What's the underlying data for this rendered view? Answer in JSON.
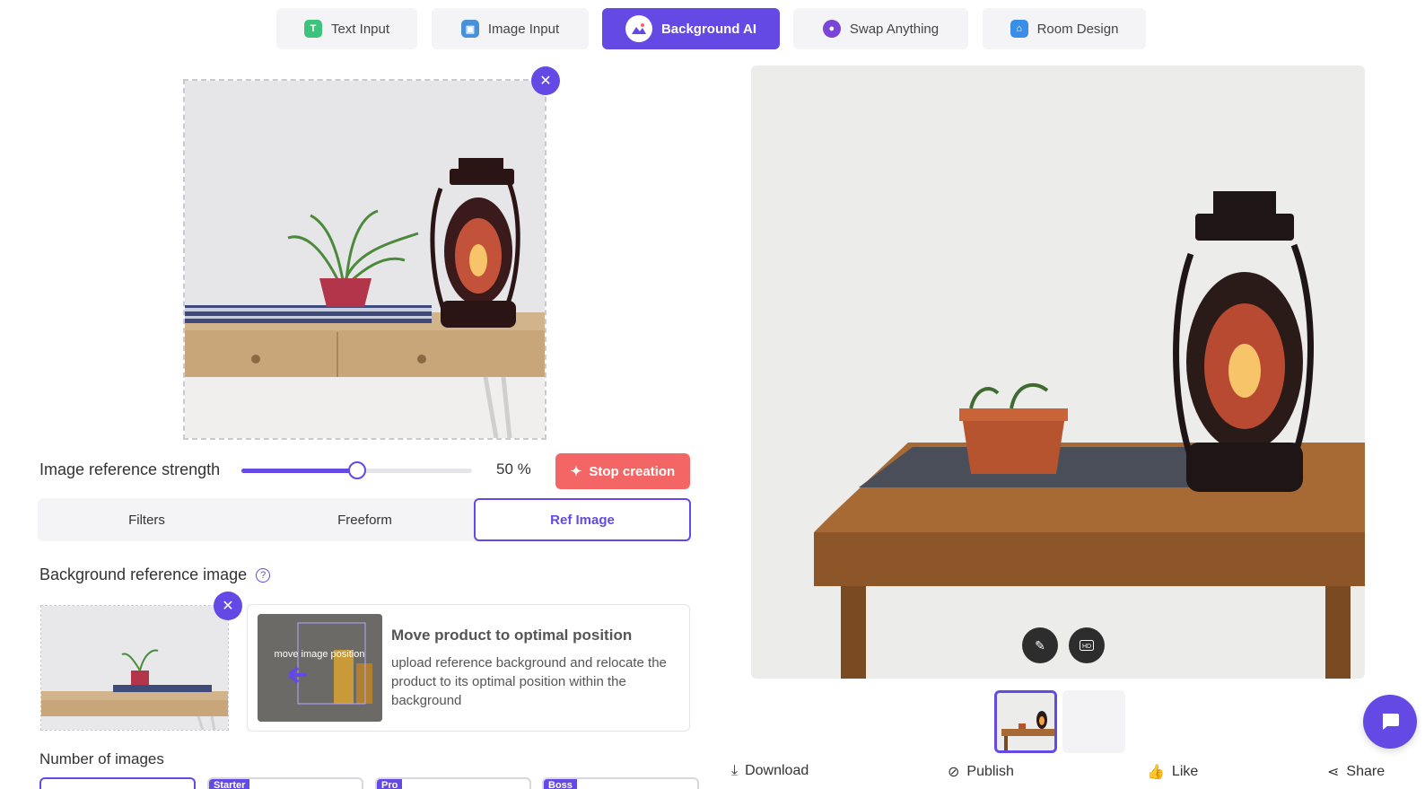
{
  "tabs": [
    {
      "label": "Text Input",
      "icon": "text-input-icon"
    },
    {
      "label": "Image Input",
      "icon": "image-input-icon"
    },
    {
      "label": "Background AI",
      "icon": "background-ai-icon",
      "active": true
    },
    {
      "label": "Swap Anything",
      "icon": "swap-anything-icon"
    },
    {
      "label": "Room Design",
      "icon": "room-design-icon"
    }
  ],
  "editor": {
    "slider_label": "Image reference strength",
    "slider_value": 50,
    "slider_value_text": "50 %",
    "stop_button": "Stop creation",
    "mode_tabs": [
      "Filters",
      "Freeform",
      "Ref Image"
    ],
    "active_mode": "Ref Image",
    "bg_ref_label": "Background reference image",
    "tip": {
      "image_caption": "move image position",
      "title": "Move product to optimal position",
      "description": "upload reference background and relocate the product to its optimal position within the background"
    },
    "num_images_label": "Number of images",
    "num_image_options": [
      {
        "badge": ""
      },
      {
        "badge": "Starter"
      },
      {
        "badge": "Pro"
      },
      {
        "badge": "Boss"
      }
    ]
  },
  "result": {
    "actions": [
      "Download",
      "Publish",
      "Like",
      "Share"
    ]
  },
  "colors": {
    "accent": "#6449e4",
    "stop": "#f46666"
  }
}
